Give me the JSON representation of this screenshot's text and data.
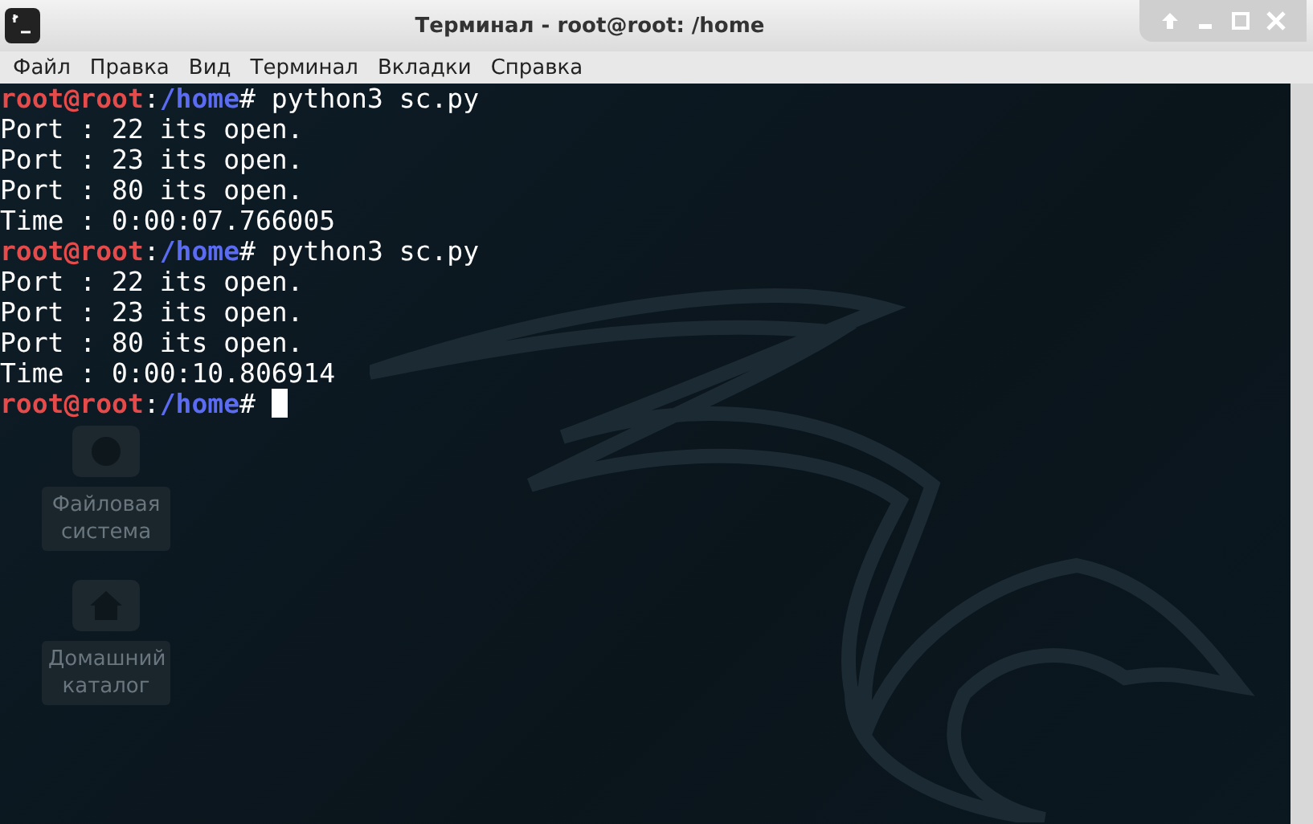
{
  "window": {
    "title": "Терминал - root@root: /home"
  },
  "menu": [
    "Файл",
    "Правка",
    "Вид",
    "Терминал",
    "Вкладки",
    "Справка"
  ],
  "lines": [
    {
      "kind": "prompt",
      "user": "root@root",
      "separator": ":",
      "path": "/home",
      "symbol": "#",
      "command": "python3 sc.py"
    },
    {
      "kind": "output",
      "text": "Port : 22 its open."
    },
    {
      "kind": "output",
      "text": "Port : 23 its open."
    },
    {
      "kind": "output",
      "text": "Port : 80 its open."
    },
    {
      "kind": "output",
      "text": "Time : 0:00:07.766005"
    },
    {
      "kind": "prompt",
      "user": "root@root",
      "separator": ":",
      "path": "/home",
      "symbol": "#",
      "command": "python3 sc.py"
    },
    {
      "kind": "output",
      "text": "Port : 22 its open."
    },
    {
      "kind": "output",
      "text": "Port : 23 its open."
    },
    {
      "kind": "output",
      "text": "Port : 80 its open."
    },
    {
      "kind": "output",
      "text": "Time : 0:00:10.806914"
    },
    {
      "kind": "prompt",
      "user": "root@root",
      "separator": ":",
      "path": "/home",
      "symbol": "#",
      "cursor": true
    }
  ],
  "desktop_icons": [
    {
      "kind": "drive",
      "label": "Файловая система"
    },
    {
      "kind": "home",
      "label": "Домашний каталог"
    }
  ]
}
